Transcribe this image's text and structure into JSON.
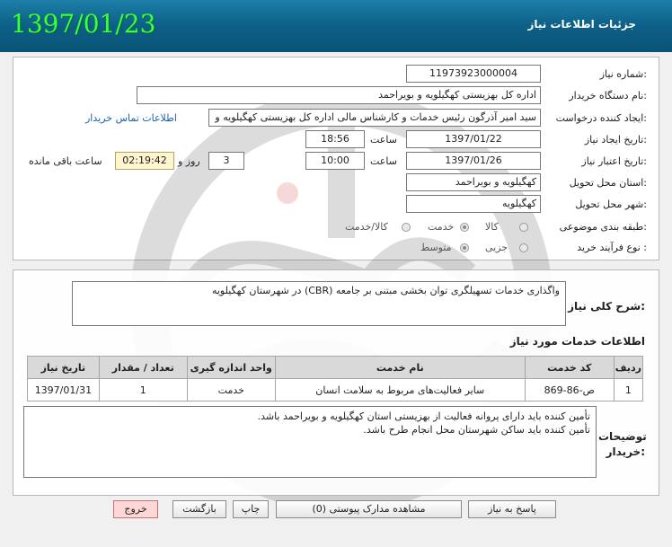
{
  "header": {
    "title": "جزئیات اطلاعات نیاز",
    "date": "1397/01/23"
  },
  "form": {
    "need_number": {
      "label": "شماره نیاز:",
      "value": "11973923000004"
    },
    "buyer_org": {
      "label": "نام دستگاه خریدار:",
      "value": "اداره کل بهزیستی کهگیلویه و بویراحمد"
    },
    "requester": {
      "label": "ایجاد کننده درخواست:",
      "value": "سید امیر آذرگون رئیس خدمات و کارشناس مالی اداره کل بهزیستی کهگیلویه و",
      "contact_link": "اطلاعات تماس خریدار"
    },
    "create_date": {
      "label": "تاریخ ایجاد نیاز:",
      "date": "1397/01/22",
      "time_label": "ساعت",
      "time": "18:56"
    },
    "validity": {
      "label": "تاریخ اعتبار نیاز:",
      "date": "1397/01/26",
      "time_label": "ساعت",
      "time": "10:00",
      "days": "3",
      "days_label": "روز و",
      "remaining": "02:19:42",
      "remaining_label": "ساعت باقی مانده"
    },
    "province": {
      "label": "استان محل تحویل:",
      "value": "کهگیلویه و بویراحمد"
    },
    "city": {
      "label": "شهر محل تحویل:",
      "value": "کهگیلویه"
    },
    "category": {
      "label": "طبقه بندی موضوعی:",
      "options": [
        "کالا",
        "خدمت",
        "کالا/خدمت"
      ],
      "selected": "خدمت"
    },
    "process": {
      "label": "نوع فرآیند خرید :",
      "options": [
        "جزیی",
        "متوسط"
      ],
      "selected": "متوسط"
    }
  },
  "description": {
    "label": "شرح کلی نیاز:",
    "text": "واگذاری خدمات تسهیلگری توان بخشی مبتنی بر جامعه (CBR) در شهرستان کهگیلویه"
  },
  "services": {
    "title": "اطلاعات خدمات مورد نیاز",
    "columns": [
      "ردیف",
      "کد خدمت",
      "نام خدمت",
      "واحد اندازه گیری",
      "تعداد / مقدار",
      "تاریخ نیاز"
    ],
    "rows": [
      [
        "1",
        "ص-86-869",
        "سایر فعالیت‌های مربوط به سلامت انسان",
        "خدمت",
        "1",
        "1397/01/31"
      ]
    ]
  },
  "buyer_notes": {
    "label": "توضیحات خریدار:",
    "lines": [
      "تأمین کننده باید دارای پروانه فعالیت از بهزیستی استان کهگیلویه و بویراحمد باشد.",
      "تأمین کننده باید ساکن شهرستان محل انجام طرح باشد."
    ]
  },
  "buttons": {
    "reply": "پاسخ به نیاز",
    "attachments": "مشاهده مدارک پیوستی (0)",
    "print": "چاپ",
    "back": "بازگشت",
    "exit": "خروج"
  },
  "colors": {
    "header": "#0c5f86",
    "date": "#3cff3c",
    "exit_button": "#ffd7d7"
  }
}
